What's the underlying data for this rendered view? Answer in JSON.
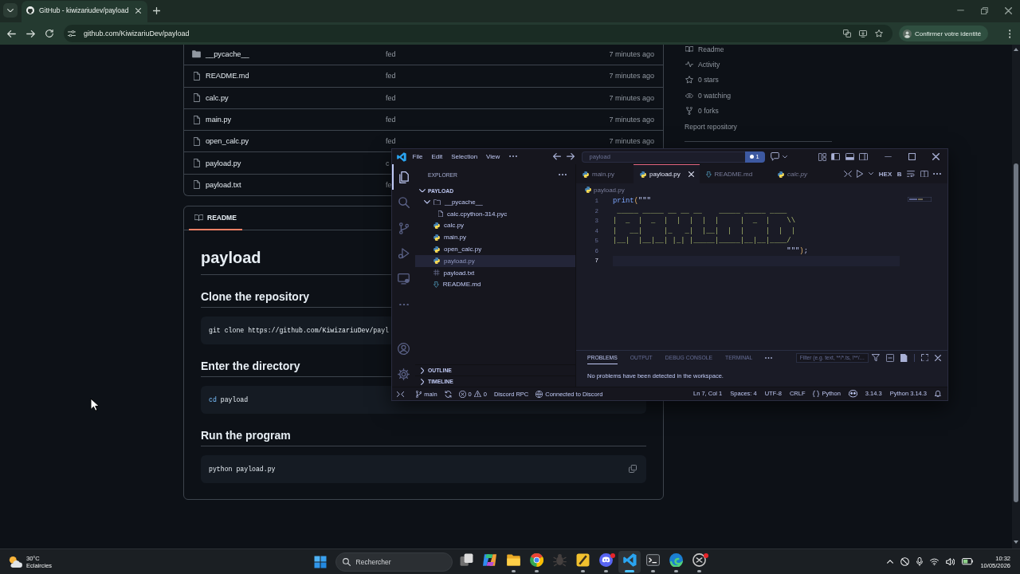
{
  "browser": {
    "tabs": [
      {
        "title": "GitHub - kiwizariudev/payload",
        "selected": true
      }
    ],
    "address": "github.com/KiwizariuDev/payload",
    "identity_button": "Confirmer votre identité"
  },
  "repository": {
    "files": [
      {
        "kind": "folder",
        "name": "__pycache__",
        "message": "fed",
        "time": "7 minutes ago"
      },
      {
        "kind": "file",
        "name": "README.md",
        "message": "fed",
        "time": "7 minutes ago"
      },
      {
        "kind": "file",
        "name": "calc.py",
        "message": "fed",
        "time": "7 minutes ago"
      },
      {
        "kind": "file",
        "name": "main.py",
        "message": "fed",
        "time": "7 minutes ago"
      },
      {
        "kind": "file",
        "name": "open_calc.py",
        "message": "fed",
        "time": "7 minutes ago"
      },
      {
        "kind": "file",
        "name": "payload.py",
        "message": "c"
      },
      {
        "kind": "file",
        "name": "payload.txt",
        "message": "fe"
      }
    ],
    "readme": {
      "tab": {
        "label": "README",
        "selected": true
      },
      "title": "payload",
      "sections": [
        {
          "heading": "Clone the repository",
          "code": [
            {
              "kind": "plain",
              "text": "git clone https://github.com/KiwizariuDev/payl"
            }
          ]
        },
        {
          "heading": "Enter the directory",
          "code": [
            {
              "kind": "builtin",
              "text": "cd"
            },
            {
              "kind": "plain",
              "text": " payload"
            }
          ]
        },
        {
          "heading": "Run the program",
          "code": [
            {
              "kind": "plain",
              "text": "python payload.py"
            }
          ],
          "copy_button": true
        }
      ]
    },
    "about": [
      {
        "kind": "readme",
        "label": "Readme"
      },
      {
        "kind": "activity",
        "label": "Activity"
      },
      {
        "kind": "stars",
        "label": "0 stars"
      },
      {
        "kind": "watchers",
        "label": "0 watching"
      },
      {
        "kind": "forks",
        "label": "0 forks"
      },
      {
        "kind": "link",
        "label": "Report repository"
      }
    ]
  },
  "vscode": {
    "menu": [
      "File",
      "Edit",
      "Selection",
      "View"
    ],
    "command_center": "payload",
    "notification_count": "1",
    "activity_bar": {
      "top": [
        {
          "kind": "explorer",
          "selected": true
        },
        {
          "kind": "search",
          "selected": false
        },
        {
          "kind": "source-control",
          "selected": false
        },
        {
          "kind": "run-debug",
          "selected": false
        },
        {
          "kind": "remote",
          "selected": false
        },
        {
          "kind": "more",
          "selected": false
        }
      ],
      "bottom": [
        {
          "kind": "account",
          "selected": false
        },
        {
          "kind": "settings",
          "selected": false
        }
      ]
    },
    "explorer": {
      "title": "EXPLORER",
      "root": {
        "label": "PAYLOAD",
        "expanded": true,
        "children": [
          {
            "kind": "folder",
            "name": "__pycache__",
            "expanded": true,
            "selected": false,
            "children": [
              {
                "kind": "binary",
                "name": "calc.cpython-314.pyc",
                "selected": false
              }
            ]
          },
          {
            "kind": "python",
            "name": "calc.py",
            "selected": false
          },
          {
            "kind": "python",
            "name": "main.py",
            "selected": false
          },
          {
            "kind": "python",
            "name": "open_calc.py",
            "selected": false
          },
          {
            "kind": "python",
            "name": "payload.py",
            "selected": true
          },
          {
            "kind": "text",
            "name": "payload.txt",
            "selected": false
          },
          {
            "kind": "markdown",
            "name": "README.md",
            "selected": false
          }
        ]
      },
      "sections": [
        {
          "label": "OUTLINE",
          "expanded": false
        },
        {
          "label": "TIMELINE",
          "expanded": false
        }
      ]
    },
    "tabs": [
      {
        "kind": "python",
        "label": "main.py",
        "selected": false,
        "preview": false
      },
      {
        "kind": "python",
        "label": "payload.py",
        "selected": true,
        "preview": false
      },
      {
        "kind": "markdown",
        "label": "README.md",
        "selected": false,
        "preview": false
      },
      {
        "kind": "python",
        "label": "calc.py",
        "selected": false,
        "preview": true
      }
    ],
    "toolbar_labels": [
      "HEX",
      "B"
    ],
    "breadcrumb": {
      "kind": "python",
      "label": "payload.py"
    },
    "code": [
      {
        "number": "1",
        "selected": false,
        "tokens": [
          {
            "kind": "function",
            "text": "print"
          },
          {
            "kind": "bracket",
            "text": "("
          },
          {
            "kind": "quote",
            "text": "\"\"\""
          }
        ]
      },
      {
        "number": "2",
        "selected": false,
        "tokens": [
          {
            "kind": "string",
            "text": " _____ _____ __ __ __    _____ _____ ____"
          }
        ]
      },
      {
        "number": "3",
        "selected": false,
        "tokens": [
          {
            "kind": "string",
            "text": "|  _  |  _  |  |  |  |  |     |  _  |    \\\\"
          }
        ]
      },
      {
        "number": "4",
        "selected": false,
        "tokens": [
          {
            "kind": "string",
            "text": "|   __|     |_   _|  |__|  |  |     |  |  |"
          }
        ]
      },
      {
        "number": "5",
        "selected": false,
        "tokens": [
          {
            "kind": "string",
            "text": "|__|  |__|__| |_| |_____|_____|__|__|____/"
          }
        ]
      },
      {
        "number": "6",
        "selected": false,
        "tokens": [
          {
            "kind": "quote",
            "text": "                                         \"\"\""
          },
          {
            "kind": "bracket",
            "text": ")"
          },
          {
            "kind": "plain",
            "text": ";"
          }
        ]
      },
      {
        "number": "7",
        "selected": true
      }
    ],
    "panel": {
      "tabs": [
        {
          "label": "PROBLEMS",
          "selected": true
        },
        {
          "label": "OUTPUT",
          "selected": false
        },
        {
          "label": "DEBUG CONSOLE",
          "selected": false
        },
        {
          "label": "TERMINAL",
          "selected": false
        }
      ],
      "filter_placeholder": "Filter (e.g. text, **/*.ts, !**/…",
      "message": "No problems have been detected in the workspace."
    },
    "status_bar": {
      "branch": "main",
      "errors": "0",
      "warnings": "0",
      "discord_rpc": "Discord RPC",
      "discord_status": "Connected to Discord",
      "cursor": "Ln 7, Col 1",
      "indentation": "Spaces: 4",
      "encoding": "UTF-8",
      "line_endings": "CRLF",
      "language": "Python",
      "version": "3.14.3",
      "interpreter": "Python 3.14.3"
    }
  },
  "taskbar": {
    "weather": {
      "temperature": "30°C",
      "condition": "Eclaircies"
    },
    "search_placeholder": "Rechercher",
    "apps": [
      {
        "kind": "task-view",
        "running": false,
        "selected": false,
        "notification": false
      },
      {
        "kind": "copilot",
        "running": false,
        "selected": false,
        "notification": false
      },
      {
        "kind": "files",
        "running": true,
        "selected": false,
        "notification": false
      },
      {
        "kind": "chrome",
        "running": true,
        "selected": false,
        "notification": false
      },
      {
        "kind": "bug",
        "running": false,
        "selected": false,
        "notification": false
      },
      {
        "kind": "tile",
        "running": true,
        "selected": false,
        "notification": false
      },
      {
        "kind": "discord",
        "running": true,
        "selected": false,
        "notification": true
      },
      {
        "kind": "vscode",
        "running": true,
        "selected": true,
        "notification": false
      },
      {
        "kind": "terminal",
        "running": true,
        "selected": false,
        "notification": false
      },
      {
        "kind": "edge",
        "running": true,
        "selected": false,
        "notification": false
      },
      {
        "kind": "knot",
        "running": true,
        "selected": false,
        "notification": true
      }
    ],
    "clock": {
      "time": "10:32",
      "date": "10/05/2026"
    }
  }
}
